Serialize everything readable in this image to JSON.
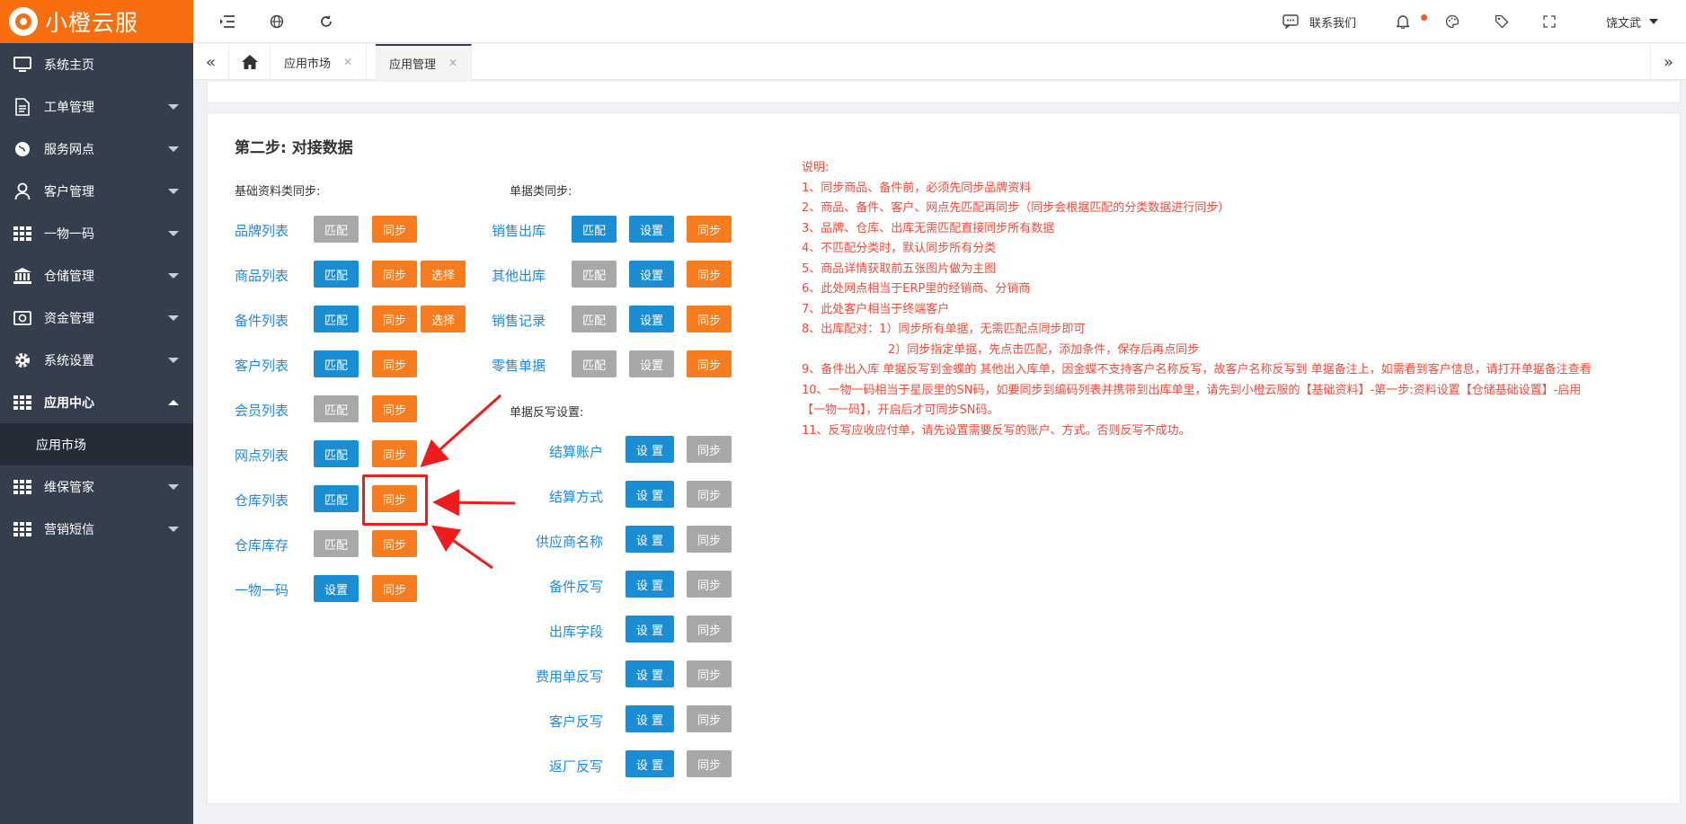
{
  "brand": {
    "name": "小橙云服"
  },
  "sidebar": {
    "items": [
      {
        "label": "系统主页",
        "icon": "monitor-icon"
      },
      {
        "label": "工单管理",
        "icon": "document-icon"
      },
      {
        "label": "服务网点",
        "icon": "globe-icon"
      },
      {
        "label": "客户管理",
        "icon": "user-icon"
      },
      {
        "label": "一物一码",
        "icon": "grid-icon"
      },
      {
        "label": "仓储管理",
        "icon": "bank-icon"
      },
      {
        "label": "资金管理",
        "icon": "money-icon"
      },
      {
        "label": "系统设置",
        "icon": "gear-icon"
      },
      {
        "label": "应用中心",
        "icon": "grid-icon"
      }
    ],
    "submenu_label": "应用市场",
    "items_after": [
      {
        "label": "维保管家",
        "icon": "grid-icon"
      },
      {
        "label": "营销短信",
        "icon": "grid-icon"
      }
    ]
  },
  "topbar": {
    "contact": "联系我们",
    "user": "饶文武"
  },
  "tabs": {
    "items": [
      "应用市场",
      "应用管理"
    ]
  },
  "content": {
    "step_title": "第二步: 对接数据",
    "basic_heading": "基础资料类同步:",
    "doc_heading": "单据类同步:",
    "writeback_heading": "单据反写设置:",
    "buttons": {
      "match": "匹配",
      "sync": "同步",
      "select": "选择",
      "set": "设置",
      "set_spaced": "设 置"
    },
    "basic_rows": [
      "品牌列表",
      "商品列表",
      "备件列表",
      "客户列表",
      "会员列表",
      "网点列表",
      "仓库列表",
      "仓库库存",
      "一物一码"
    ],
    "doc_rows": [
      "销售出库",
      "其他出库",
      "销售记录",
      "零售单据"
    ],
    "writeback_rows": [
      "结算账户",
      "结算方式",
      "供应商名称",
      "备件反写",
      "出库字段",
      "费用单反写",
      "客户反写",
      "返厂反写"
    ],
    "notes": [
      "说明:",
      "1、同步商品、备件前，必须先同步品牌资料",
      "2、商品、备件、客户、网点先匹配再同步（同步会根据匹配的分类数据进行同步）",
      "3、品牌、仓库、出库无需匹配直接同步所有数据",
      "4、不匹配分类时，默认同步所有分类",
      "5、商品详情获取前五张图片做为主图",
      "6、此处网点相当于ERP里的经销商、分销商",
      "7、此处客户相当于终端客户",
      "8、出库配对：1）同步所有单据，无需匹配点同步即可",
      "2）同步指定单据，先点击匹配，添加条件，保存后再点同步",
      "9、备件出入库 单据反写到金蝶的 其他出入库单，因金蝶不支持客户名称反写，故客户名称反写到 单据备注上，如需看到客户信息，请打开单据备注查看",
      "10、一物一码相当于星辰里的SN码，如要同步到编码列表并携带到出库单里，请先到小橙云服的【基础资料】-第一步:资料设置【仓储基础设置】-启用【一物一码】，开启后才可同步SN码。",
      "11、反写应收应付单，请先设置需要反写的账户、方式。否则反写不成功。"
    ]
  },
  "colors": {
    "brand": "#f86e0f",
    "sidebar": "#353e4d",
    "gray_btn": "#a8a8a8",
    "blue_btn": "#1b8ed3",
    "orange_btn": "#f57c1f",
    "note_red": "#f54a3b"
  }
}
